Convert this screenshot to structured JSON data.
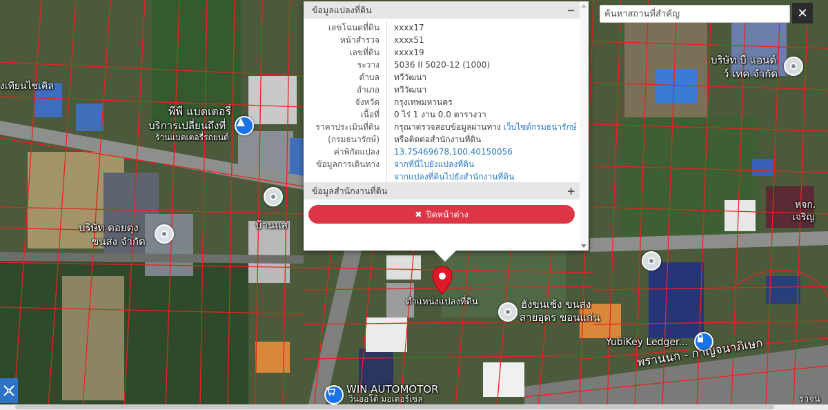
{
  "search": {
    "placeholder": "ค้นหาสถานที่สำคัญ",
    "close_label": "✕"
  },
  "popup": {
    "section_title": "ข้อมูลแปลงที่ดิน",
    "section_toggle": "−",
    "rows": [
      {
        "key": "เลขโฉนดที่ดิน",
        "value": "xxxx17"
      },
      {
        "key": "หน้าสำรวจ",
        "value": "xxxx51"
      },
      {
        "key": "เลขที่ดิน",
        "value": "xxxx19"
      },
      {
        "key": "ระวาง",
        "value": "5036 II 5020-12 (1000)"
      },
      {
        "key": "ตำบล",
        "value": "ทวีวัฒนา"
      },
      {
        "key": "อำเภอ",
        "value": "ทวีวัฒนา"
      },
      {
        "key": "จังหวัด",
        "value": "กรุงเทพมหานคร"
      },
      {
        "key": "เนื้อที่",
        "value": "0 ไร่ 1 งาน 0.0 ตารางวา"
      }
    ],
    "price_key_1": "ราคาประเมินที่ดิน",
    "price_key_2": "(กรมธนารักษ์)",
    "price_value_1": "กรุณาตรวจสอบข้อมูลผ่านทาง ",
    "price_link": "เว็บไซต์กรมธนารักษ์",
    "price_value_2": "หรือติดต่อสำนักงานที่ดิน",
    "coord_key": "ค่าพิกัดแปลง",
    "coord_value": "13.75469678,100.40150056",
    "travel_key": "ข้อมูลการเดินทาง",
    "travel_link_1": "จากที่นี่ไปยังแปลงที่ดิน",
    "travel_link_2": "จากแปลงที่ดินไปยังสำนักงานที่ดิน",
    "office_section_title": "ข้อมูลสำนักงานที่ดิน",
    "office_section_toggle": "+",
    "close_button_icon": "✖",
    "close_button_label": "ปิดหน้าต่าง"
  },
  "map_labels": {
    "parcel_marker": "ตำแหน่งแปลงที่ดิน",
    "pp_battery_1": "พีพี แบตเตอรี่",
    "pp_battery_2": "บริการเปลี่ยนถึงที่",
    "pp_battery_3": "ร้านแบตเตอรี่รถยนต์",
    "bike": "งเทียนไซเคิล",
    "doiyung_1": "บริษัท ดอยตุง",
    "doiyung_2": "ขนส่ง จำกัด",
    "house": "บ้านแส",
    "b_and_d_1": "บริษัท บี แอนด์",
    "b_and_d_2": "ว์ เทค จำกัด",
    "hjk_1": "หจก.",
    "hjk_2": "เจริญ",
    "transport_1": "ฮังขนเซ้ง ขนส่ง",
    "transport_2": "สายอุดร ขอนแก่น",
    "yubikey": "YubiKey Ledger...",
    "road": "พรานนก - กาญจนาภิเษก",
    "road_right": "ราจน",
    "win_1": "WIN AUTOMOTOR",
    "win_2": "วินออโต้ มอเตอร์เซล"
  },
  "colors": {
    "parcel_line": "#e8231f",
    "marker": "#e0192a",
    "close_button": "#dc3545",
    "link": "#2a7bc8"
  },
  "icons": {
    "marker": "map-pin-icon",
    "poi": "poi-dot-icon",
    "lock": "lock-icon",
    "cart": "cart-icon",
    "tool": "tools-icon"
  }
}
